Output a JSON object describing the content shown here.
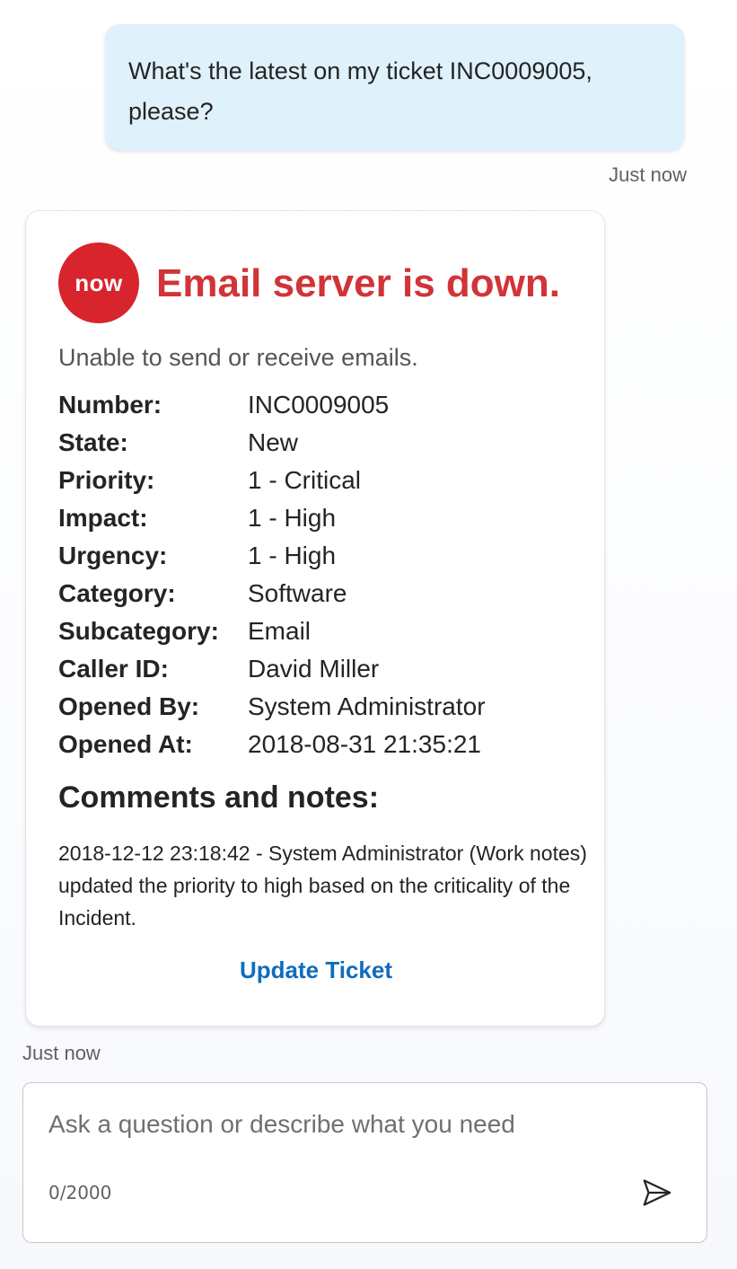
{
  "conversation": {
    "user_message": "What's the latest on my ticket INC0009005, please?",
    "user_timestamp": "Just now",
    "bot_timestamp": "Just now"
  },
  "card": {
    "logo_text": "now",
    "logo_color": "#d8242c",
    "title": "Email server is down.",
    "title_color": "#d13438",
    "subtitle": "Unable to send or receive emails.",
    "facts": [
      {
        "label": "Number:",
        "value": "INC0009005"
      },
      {
        "label": "State:",
        "value": "New"
      },
      {
        "label": "Priority:",
        "value": "1 - Critical"
      },
      {
        "label": "Impact:",
        "value": "1 - High"
      },
      {
        "label": "Urgency:",
        "value": "1 - High"
      },
      {
        "label": "Category:",
        "value": "Software"
      },
      {
        "label": "Subcategory:",
        "value": "Email"
      },
      {
        "label": "Caller ID:",
        "value": "David Miller"
      },
      {
        "label": "Opened By:",
        "value": "System Administrator"
      },
      {
        "label": "Opened At:",
        "value": "2018-08-31 21:35:21"
      }
    ],
    "comments_heading": "Comments and notes:",
    "comments_text": "2018-12-12 23:18:42 - System Administrator (Work notes) updated the priority to high based on the criticality of the Incident.",
    "action_label": "Update Ticket",
    "action_color": "#0f6cbd"
  },
  "composer": {
    "placeholder": "Ask a question or describe what you need",
    "value": "",
    "counter": "0/2000",
    "send_icon": "send-icon"
  }
}
